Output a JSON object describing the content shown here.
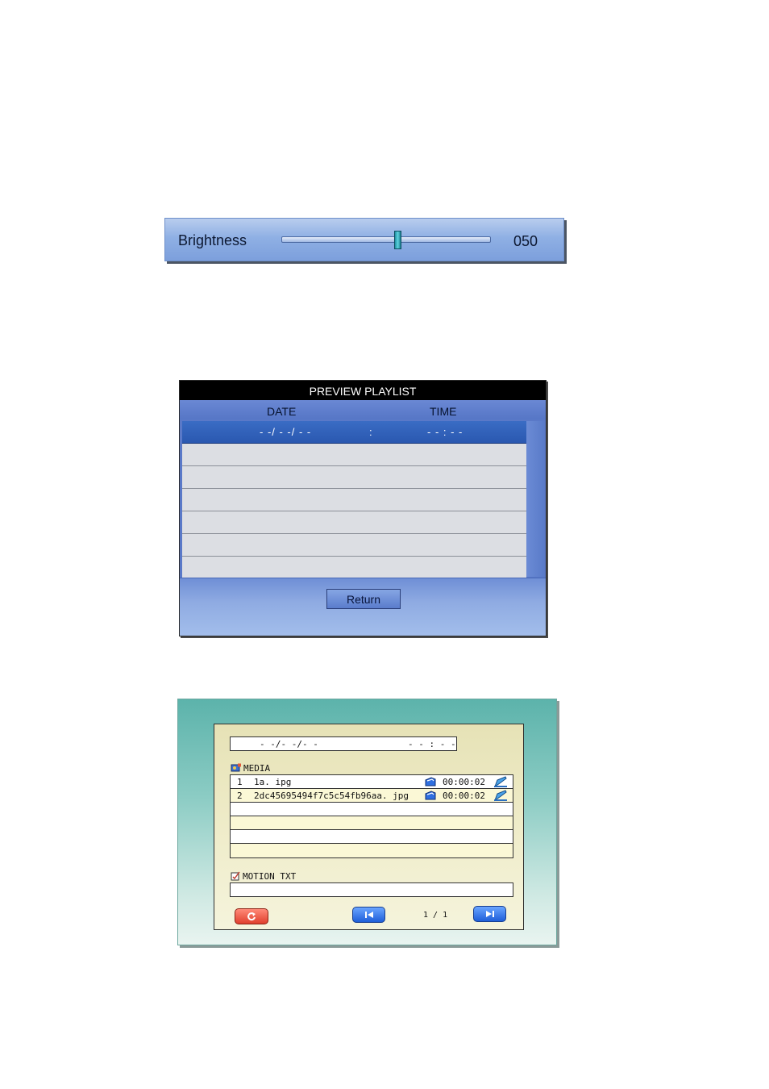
{
  "brightness": {
    "label": "Brightness",
    "value": "050",
    "level": 50
  },
  "playlist": {
    "title": "PREVIEW  PLAYLIST",
    "col_date": "DATE",
    "col_time": "TIME",
    "rows": [
      {
        "date": "- -/ - -/ - -",
        "sep": ":",
        "time": "- - : - -"
      },
      {
        "date": "",
        "sep": "",
        "time": ""
      },
      {
        "date": "",
        "sep": "",
        "time": ""
      },
      {
        "date": "",
        "sep": "",
        "time": ""
      },
      {
        "date": "",
        "sep": "",
        "time": ""
      },
      {
        "date": "",
        "sep": "",
        "time": ""
      },
      {
        "date": "",
        "sep": "",
        "time": ""
      }
    ],
    "return_label": "Return"
  },
  "media": {
    "date": "- -/- -/- -",
    "time": "- - : - -",
    "media_label": "MEDIA",
    "items": [
      {
        "num": "1",
        "file": "1a. ipg",
        "duration": "00:00:02"
      },
      {
        "num": "2",
        "file": "2dc45695494f7c5c54fb96aa. jpg",
        "duration": "00:00:02"
      },
      {
        "num": "",
        "file": "",
        "duration": ""
      },
      {
        "num": "",
        "file": "",
        "duration": ""
      },
      {
        "num": "",
        "file": "",
        "duration": ""
      },
      {
        "num": "",
        "file": "",
        "duration": ""
      }
    ],
    "motion_label": "MOTION TXT",
    "motion_text": "",
    "page": "1 / 1"
  },
  "colors": {
    "brightness_bg": "#8fb0e4",
    "playlist_selected": "#2a58b0",
    "panel_teal": "#5cb3ab",
    "refresh_button": "#e0402d",
    "nav_button": "#1f5fd9"
  },
  "icons": [
    "picture-icon",
    "edit-icon",
    "media-icon",
    "motion-txt-icon",
    "refresh-icon",
    "skip-previous-icon",
    "skip-next-icon"
  ]
}
